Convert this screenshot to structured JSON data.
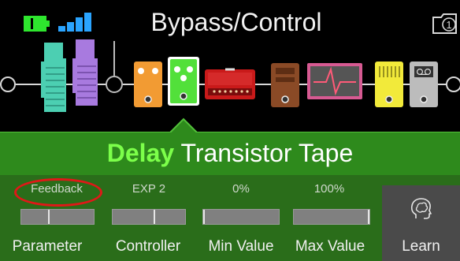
{
  "header": {
    "title": "Bypass/Control",
    "snapshot_number": "1",
    "battery_color": "#2ee62e",
    "signal_color": "#2aa4ff"
  },
  "block": {
    "category": "Delay",
    "model": "Transistor Tape",
    "accent": "#7cff4a"
  },
  "params": [
    {
      "value": "Feedback",
      "label": "Parameter",
      "level": 0.38
    },
    {
      "value": "EXP 2",
      "label": "Controller",
      "level": 0.58
    },
    {
      "value": "0%",
      "label": "Min Value",
      "level": 0.0
    },
    {
      "value": "100%",
      "label": "Max Value",
      "level": 1.0
    }
  ],
  "learn": {
    "label": "Learn",
    "icon": "brain-head-icon"
  }
}
